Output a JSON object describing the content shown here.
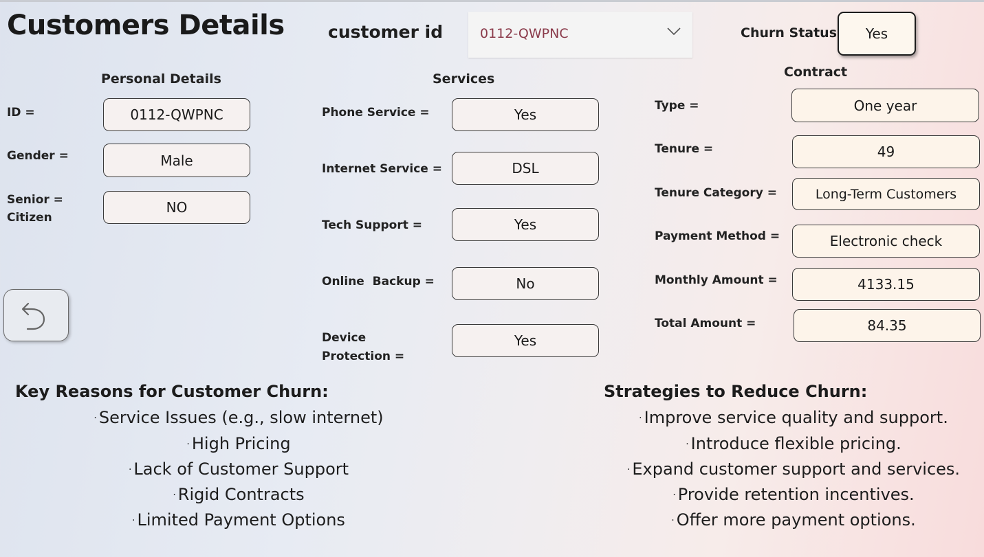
{
  "header": {
    "title": "Customers Details",
    "customer_id_label": "customer id",
    "customer_id_selected": "0112-QWPNC",
    "churn_status_label": "Churn Status",
    "churn_status_value": "Yes"
  },
  "personal": {
    "heading": "Personal Details",
    "id_label": "ID =",
    "id_value": "0112-QWPNC",
    "gender_label": "Gender =",
    "gender_value": "Male",
    "senior_label_1": "Senior =",
    "senior_label_2": "Citizen",
    "senior_value": "NO"
  },
  "services": {
    "heading": "Services",
    "phone_label": "Phone Service =",
    "phone_value": "Yes",
    "internet_label": "Internet Service =",
    "internet_value": "DSL",
    "tech_label": "Tech Support =",
    "tech_value": "Yes",
    "backup_label": "Online  Backup =",
    "backup_value": "No",
    "device_label_1": "Device",
    "device_label_2": "Protection =",
    "device_value": "Yes"
  },
  "contract": {
    "heading": "Contract",
    "type_label": "Type =",
    "type_value": "One year",
    "tenure_label": "Tenure =",
    "tenure_value": "49",
    "tenure_cat_label": "Tenure Category =",
    "tenure_cat_value": "Long-Term Customers",
    "payment_label": "Payment Method =",
    "payment_value": "Electronic check",
    "monthly_label": "Monthly Amount =",
    "monthly_value": "4133.15",
    "total_label": "Total Amount =",
    "total_value": "84.35"
  },
  "reasons": {
    "heading": "Key Reasons for Customer Churn:",
    "items": [
      "Service Issues (e.g., slow internet)",
      "High Pricing",
      "Lack of Customer Support",
      "Rigid Contracts",
      "Limited Payment Options"
    ]
  },
  "strategies": {
    "heading": "Strategies to Reduce Churn:",
    "items": [
      "Improve service quality and support.",
      "Introduce flexible pricing.",
      "Expand customer support and services.",
      "Provide retention incentives.",
      "Offer more payment options."
    ]
  },
  "icons": {
    "back": "undo-arrow-icon",
    "dropdown": "chevron-down-icon"
  },
  "colors": {
    "slicer_text": "#8a3a4a",
    "box_border": "#3a3a3a"
  }
}
